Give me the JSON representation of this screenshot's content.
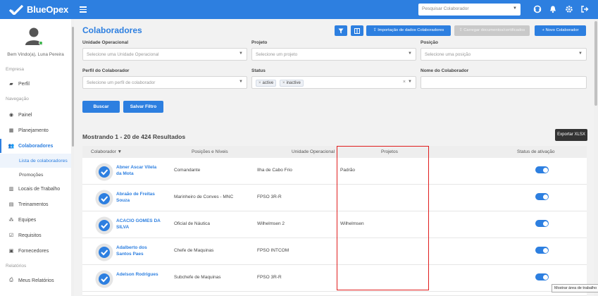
{
  "app": {
    "name": "BlueOpex"
  },
  "topbar": {
    "search_placeholder": "Pesquisar Colaborador"
  },
  "sidebar": {
    "welcome": "Bem Vindo(a), Luna Pereira",
    "section_empresa": "Empresa",
    "section_navegacao": "Navegação",
    "section_relatorios": "Relatórios",
    "items": [
      {
        "label": "Perfil",
        "icon": "briefcase-icon"
      },
      {
        "label": "Painel",
        "icon": "dashboard-icon"
      },
      {
        "label": "Planejamento",
        "icon": "calendar-icon"
      },
      {
        "label": "Colaboradores",
        "icon": "users-icon"
      },
      {
        "label": "Locais de Trabalho",
        "icon": "building-icon"
      },
      {
        "label": "Treinamentos",
        "icon": "training-icon"
      },
      {
        "label": "Equipes",
        "icon": "team-icon"
      },
      {
        "label": "Requisitos",
        "icon": "checkbox-icon"
      },
      {
        "label": "Fornecedores",
        "icon": "supplier-icon"
      },
      {
        "label": "Meus Relatórios",
        "icon": "print-icon"
      }
    ],
    "subitems": [
      {
        "label": "Lista de colaboradores"
      },
      {
        "label": "Promoções"
      }
    ]
  },
  "page": {
    "title": "Colaboradores",
    "buttons": {
      "import": "Importação de dados Colaboradores",
      "upload_docs": "Carregar documentos/certificados",
      "new": "+ Novo Colaborador"
    }
  },
  "filters": {
    "unit_label": "Unidade Operacional",
    "unit_placeholder": "Selecione uma Unidade Operacional",
    "project_label": "Projeto",
    "project_placeholder": "Selecione um projeto",
    "position_label": "Posição",
    "position_placeholder": "Selecione uma posição",
    "profile_label": "Perfil do Colaborador",
    "profile_placeholder": "Selecione um perfil de colaborador",
    "status_label": "Status",
    "status_tags": [
      "active",
      "inactive"
    ],
    "name_label": "Nome do Colaborador",
    "search_button": "Buscar",
    "save_button": "Salvar Filtro"
  },
  "results": {
    "summary": "Mostrando 1 - 20 de 424 Resultados",
    "export_button": "Exportar XLSX"
  },
  "table": {
    "headers": {
      "name": "Colaborador ▼",
      "positions": "Posições e Níveis",
      "unit": "Unidade Operacional",
      "projects": "Projetos",
      "status": "Status de ativação"
    },
    "rows": [
      {
        "name": "Abner Ascar Vilela da Mota",
        "position": "Comandante",
        "unit": "Ilha de Cabo Frio",
        "project": "Padrão",
        "active": true
      },
      {
        "name": "Abraão de Freitas Souza",
        "position": "Marinheiro de Conves - MNC",
        "unit": "FPSO 3R-R",
        "project": "",
        "active": true
      },
      {
        "name": "ACACIO GOMES DA SILVA",
        "position": "Oficial de Náutica",
        "unit": "Wilhelmsen 2",
        "project": "Wilhelmsen",
        "active": true
      },
      {
        "name": "Adalberto dos Santos Paes",
        "position": "Chefe de Maquinas",
        "unit": "FPSO INTCOM",
        "project": "",
        "active": true
      },
      {
        "name": "Adelson Rodrigues",
        "position": "Subchefe de Maquinas",
        "unit": "FPSO 3R-R",
        "project": "",
        "active": true
      }
    ]
  },
  "tooltip": "Mostrar área de trabalho",
  "colors": {
    "primary": "#2d7fe0",
    "highlight": "#e11d1d"
  }
}
